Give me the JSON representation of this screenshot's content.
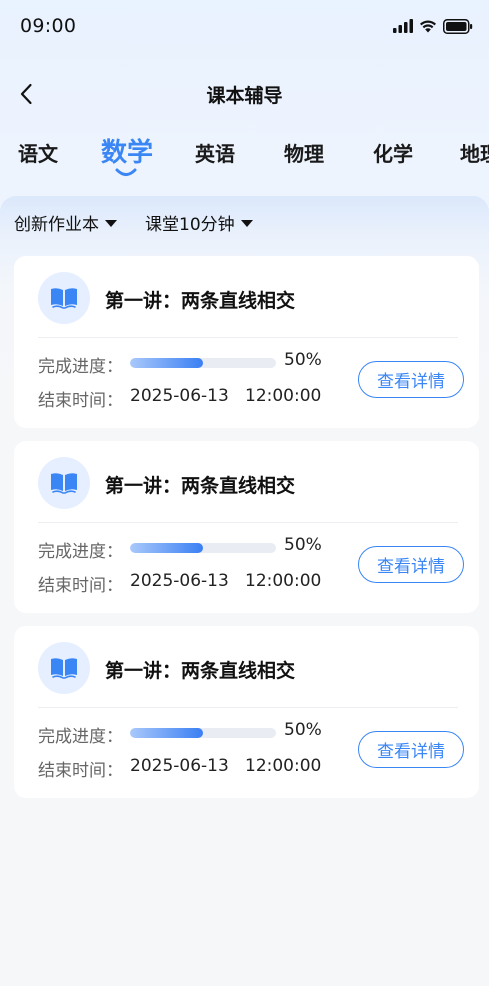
{
  "status_bar": {
    "time": "09:00"
  },
  "nav": {
    "title": "课本辅导"
  },
  "subjects": [
    {
      "label": "语文",
      "active": false
    },
    {
      "label": "数学",
      "active": true
    },
    {
      "label": "英语",
      "active": false
    },
    {
      "label": "物理",
      "active": false
    },
    {
      "label": "化学",
      "active": false
    },
    {
      "label": "地理",
      "active": false
    }
  ],
  "filters": [
    {
      "label": "创新作业本"
    },
    {
      "label": "课堂10分钟"
    }
  ],
  "cards": [
    {
      "title": "第一讲：两条直线相交",
      "progress_label": "完成进度：",
      "progress_percent": 50,
      "progress_text": "50%",
      "end_label": "结束时间：",
      "end_time": "2025-06-13   12:00:00",
      "button_label": "查看详情"
    },
    {
      "title": "第一讲：两条直线相交",
      "progress_label": "完成进度：",
      "progress_percent": 50,
      "progress_text": "50%",
      "end_label": "结束时间：",
      "end_time": "2025-06-13   12:00:00",
      "button_label": "查看详情"
    },
    {
      "title": "第一讲：两条直线相交",
      "progress_label": "完成进度：",
      "progress_percent": 50,
      "progress_text": "50%",
      "end_label": "结束时间：",
      "end_time": "2025-06-13   12:00:00",
      "button_label": "查看详情"
    }
  ],
  "colors": {
    "accent": "#3a86f5",
    "icon_bg": "#e5efff",
    "text_primary": "#111111",
    "text_secondary": "#666666"
  },
  "icons": {
    "back": "chevron-left-icon",
    "book": "open-book-icon",
    "signal": "signal-icon",
    "wifi": "wifi-icon",
    "battery": "battery-icon"
  }
}
